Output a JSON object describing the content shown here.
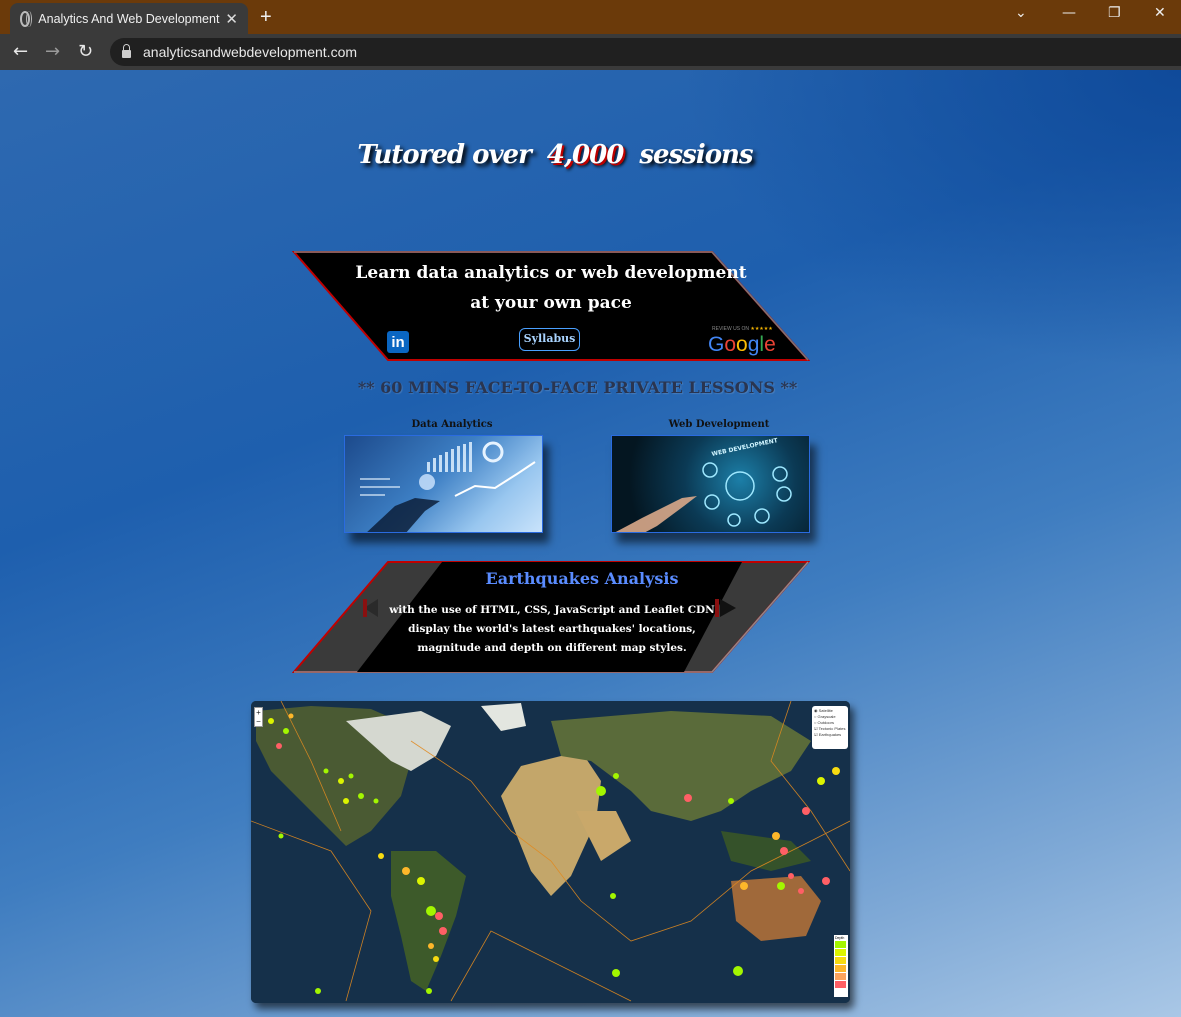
{
  "browser": {
    "tab_title": "Analytics And Web Development",
    "tab_close": "✕",
    "new_tab": "+",
    "url": "analyticsandwebdevelopment.com",
    "controls": {
      "dropdown": "⌄",
      "minimize": "—",
      "restore": "❐",
      "close": "✕"
    },
    "nav": {
      "back": "←",
      "forward": "→",
      "reload": "↻"
    }
  },
  "headline": {
    "before": "Tutored over",
    "number": "4,000",
    "after": "sessions"
  },
  "banner_learn": {
    "line1": "Learn data analytics or web development",
    "line2": "at your own pace",
    "linkedin": "in",
    "syllabus": "Syllabus",
    "review_text": "REVIEW US ON",
    "review_stars": "★★★★★",
    "google": "Google"
  },
  "lessons_text": "** 60 MINS FACE-TO-FACE PRIVATE LESSONS **",
  "cards": [
    {
      "label": "Data Analytics"
    },
    {
      "label": "Web Development"
    }
  ],
  "earthquakes": {
    "title": "Earthquakes Analysis",
    "line1": "with the use of HTML, CSS, JavaScript and Leaflet CDN",
    "line2": "display the world's latest earthquakes' locations,",
    "line3": "magnitude and depth on different map styles."
  },
  "map": {
    "zoom_in": "+",
    "zoom_out": "−",
    "base_layers": [
      "Satellite",
      "Grayscale",
      "Outdoors"
    ],
    "overlays": [
      "Tectonic Plates",
      "Earthquakes"
    ],
    "legend_title": "Depth",
    "legend_colors": [
      "#a3f600",
      "#dcf400",
      "#f7db11",
      "#fdb72a",
      "#fca35d",
      "#ff5f65"
    ]
  },
  "colors": {
    "accent_red": "#c00000",
    "link_blue": "#5a8cff",
    "titlebar": "#6b3a0a"
  }
}
